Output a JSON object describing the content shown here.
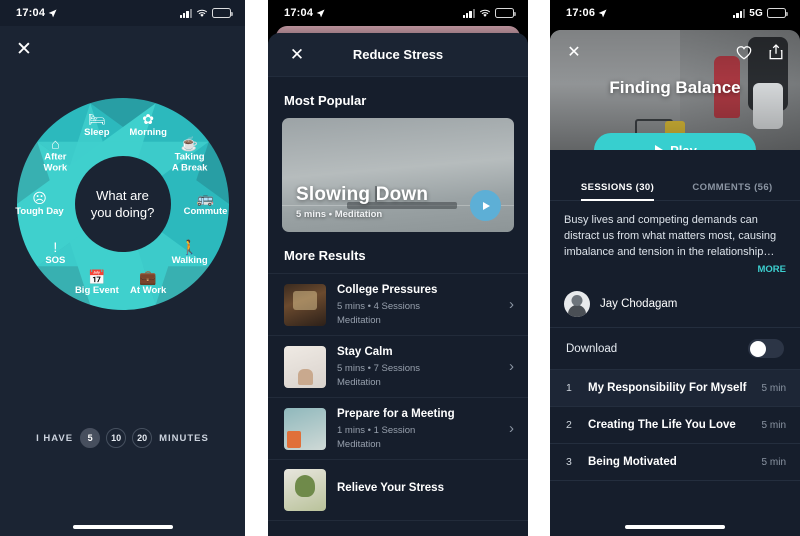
{
  "panel1": {
    "status": {
      "time": "17:04",
      "network": "",
      "location_icon": "location-arrow-icon"
    },
    "close_label": "✕",
    "hub_line1": "What are",
    "hub_line2": "you doing?",
    "segments": [
      {
        "label": "Morning",
        "icon": "✿",
        "icon_name": "flower-icon"
      },
      {
        "label": "Taking\nA Break",
        "icon": "☕",
        "icon_name": "coffee-cup-icon"
      },
      {
        "label": "Commute",
        "icon": "🚌",
        "icon_name": "bus-icon"
      },
      {
        "label": "Walking",
        "icon": "🚶",
        "icon_name": "walking-person-icon"
      },
      {
        "label": "At Work",
        "icon": "💼",
        "icon_name": "briefcase-icon"
      },
      {
        "label": "Big Event",
        "icon": "📅",
        "icon_name": "calendar-icon"
      },
      {
        "label": "SOS",
        "icon": "!",
        "icon_name": "exclamation-circle-icon"
      },
      {
        "label": "Tough Day",
        "icon": "☹",
        "icon_name": "sad-face-icon"
      },
      {
        "label": "After\nWork",
        "icon": "⌂",
        "icon_name": "home-icon"
      },
      {
        "label": "Sleep",
        "icon": "🛏",
        "icon_name": "bed-icon"
      }
    ],
    "minutes_prefix": "I HAVE",
    "minutes_suffix": "MINUTES",
    "minutes_options": [
      "5",
      "10",
      "20"
    ],
    "minutes_selected": "5",
    "colors": {
      "background": "#1b2433",
      "teal_light": "#3fd0cd",
      "teal_dark": "#2cb9bd"
    }
  },
  "panel2": {
    "status": {
      "time": "17:04"
    },
    "header": {
      "title": "Reduce Stress",
      "close_label": "✕"
    },
    "most_popular_title": "Most Popular",
    "hero": {
      "title": "Slowing Down",
      "meta": "5 mins • Meditation",
      "play_icon": "play-icon"
    },
    "more_results_title": "More Results",
    "results": [
      {
        "title": "College Pressures",
        "meta": "5 mins • 4 Sessions",
        "category": "Meditation"
      },
      {
        "title": "Stay Calm",
        "meta": "5 mins • 7 Sessions",
        "category": "Meditation"
      },
      {
        "title": "Prepare for a Meeting",
        "meta": "1 mins • 1 Session",
        "category": "Meditation"
      },
      {
        "title": "Relieve Your Stress",
        "meta": "",
        "category": ""
      }
    ],
    "chevron": "›"
  },
  "panel3": {
    "status": {
      "time": "17:06",
      "network": "5G"
    },
    "hero": {
      "title": "Finding Balance",
      "close_label": "✕",
      "heart_icon": "heart-icon",
      "share_icon": "share-icon"
    },
    "play_label": "Play",
    "tabs": [
      {
        "label": "SESSIONS (30)",
        "active": true
      },
      {
        "label": "COMMENTS (56)",
        "active": false
      }
    ],
    "description": "Busy lives and competing demands can distract us from what matters most, causing imbalance and tension in the relationship…",
    "more_label": "MORE",
    "author": {
      "name": "Jay Chodagam"
    },
    "download": {
      "label": "Download",
      "enabled": false
    },
    "sessions": [
      {
        "num": "1",
        "name": "My Responsibility For Myself",
        "duration": "5 min",
        "highlighted": true
      },
      {
        "num": "2",
        "name": "Creating The Life You Love",
        "duration": "5 min",
        "highlighted": false
      },
      {
        "num": "3",
        "name": "Being Motivated",
        "duration": "5 min",
        "highlighted": false
      }
    ],
    "accent_color": "#37cfcf"
  }
}
